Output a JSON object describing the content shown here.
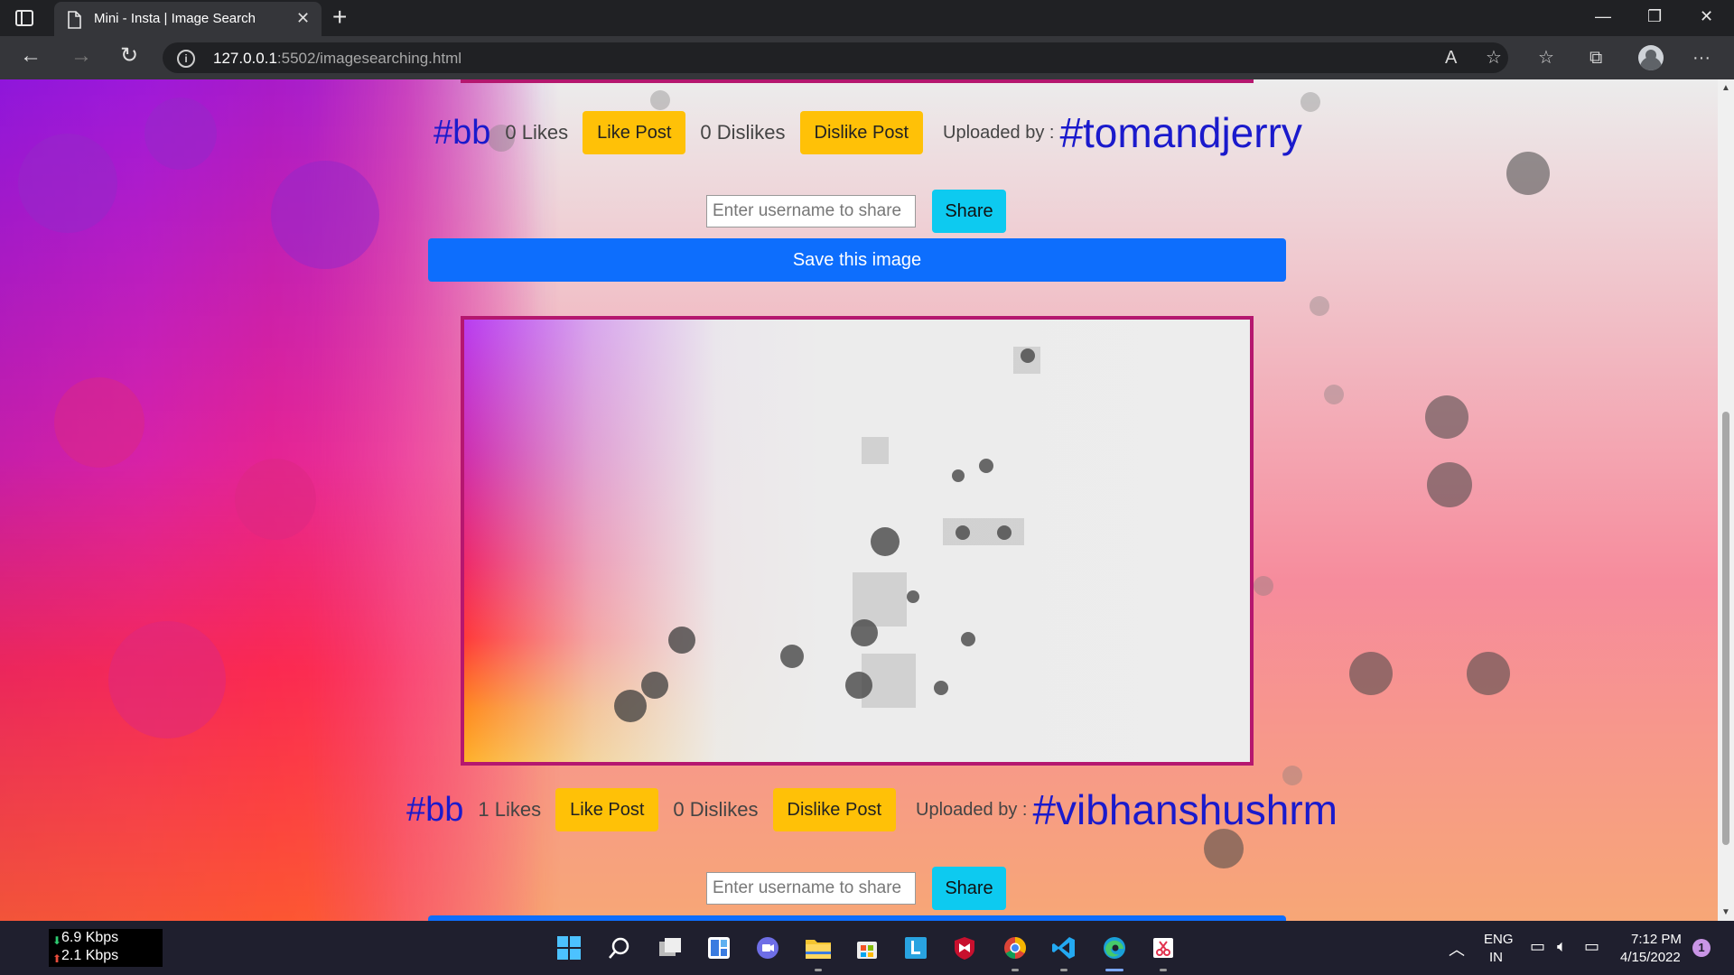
{
  "browser": {
    "tab_title": "Mini - Insta | Image Search",
    "url_host": "127.0.0.1",
    "url_path": ":5502/imagesearching.html"
  },
  "posts": [
    {
      "tag": "#bb",
      "likes": "0 Likes",
      "like_label": "Like Post",
      "dislikes": "0 Dislikes",
      "dislike_label": "Dislike Post",
      "uploaded_label": "Uploaded by :",
      "uploader": "#tomandjerry",
      "share_placeholder": "Enter username to share",
      "share_label": "Share",
      "save_label": "Save this image"
    },
    {
      "tag": "#bb",
      "likes": "1 Likes",
      "like_label": "Like Post",
      "dislikes": "0 Dislikes",
      "dislike_label": "Dislike Post",
      "uploaded_label": "Uploaded by :",
      "uploader": "#vibhanshushrm",
      "share_placeholder": "Enter username to share",
      "share_label": "Share"
    }
  ],
  "taskbar": {
    "net_down": "6.9 Kbps",
    "net_up": "2.1 Kbps",
    "lang_1": "ENG",
    "lang_2": "IN",
    "time": "7:12 PM",
    "date": "4/15/2022",
    "notification_count": "1",
    "apps": [
      "start-icon",
      "search-icon",
      "task-view-icon",
      "widgets-icon",
      "chat-icon",
      "file-explorer-icon",
      "store-icon",
      "launcher-icon",
      "mcafee-icon",
      "chrome-icon",
      "vscode-icon",
      "edge-icon",
      "snipping-tool-icon"
    ]
  },
  "colors": {
    "like_button": "#ffc107",
    "share_button": "#0dcaf0",
    "save_button": "#0d6efd",
    "image_border": "#b5176f",
    "hashtag": "#1a1acc"
  }
}
